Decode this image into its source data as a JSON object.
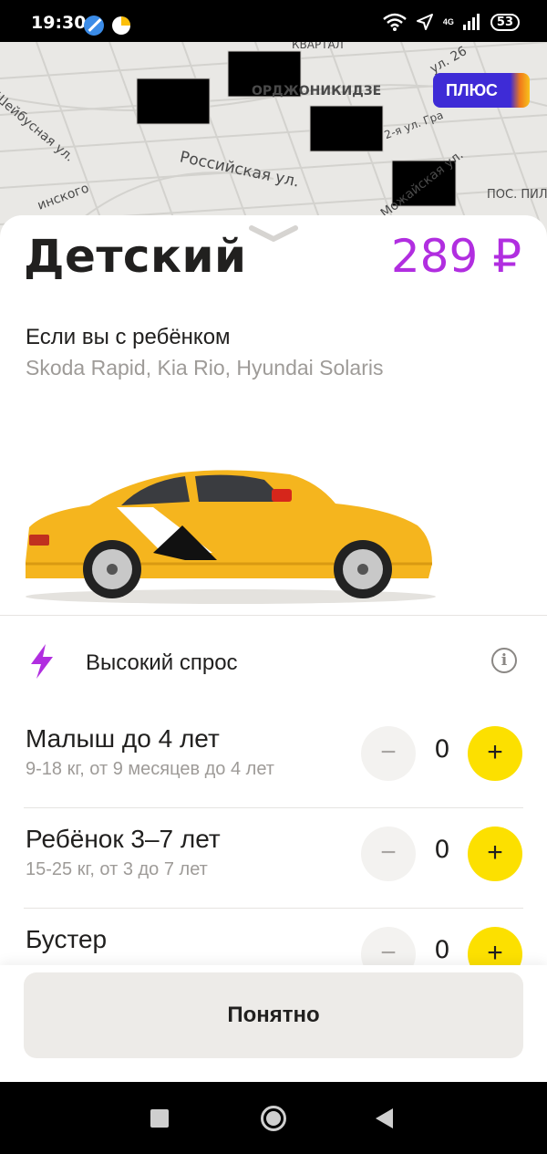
{
  "status_bar": {
    "time": "19:30",
    "network": "4G",
    "battery": "53",
    "icons": [
      "app-icon-blue",
      "app-icon-yellow",
      "wifi-icon",
      "location-arrow-icon",
      "signal-icon",
      "battery-icon"
    ]
  },
  "map": {
    "labels": [
      "ОРДЖОНИКИДЗЕ",
      "Российская ул.",
      "Можайская ул.",
      "ПОС. ПИЛ",
      "Шейбусная ул.",
      "ул. 26",
      "инского",
      "2-я ул. Гра",
      "КВАРТАЛ"
    ],
    "plus_badge": "ПЛЮС",
    "pager": {
      "count": 9,
      "active_index": 4
    }
  },
  "tariff": {
    "name": "Детский",
    "price": "289 ₽",
    "subtitle": "Если вы с ребёнком",
    "models": "Skoda Rapid, Kia Rio, Hyundai Solaris"
  },
  "demand": {
    "label": "Высокий спрос",
    "info_symbol": "i"
  },
  "child_seats": [
    {
      "title": "Малыш до 4 лет",
      "subtitle": "9-18 кг, от 9 месяцев до 4 лет",
      "count": "0",
      "minus": "−",
      "plus": "+"
    },
    {
      "title": "Ребёнок 3–7 лет",
      "subtitle": "15-25 кг, от 3 до 7 лет",
      "count": "0",
      "minus": "−",
      "plus": "+"
    },
    {
      "title": "Бустер",
      "subtitle": "",
      "count": "0",
      "minus": "−",
      "plus": "+"
    }
  ],
  "confirm_button": "Понятно",
  "colors": {
    "accent_price": "#b12ee0",
    "plus_button": "#fce000",
    "plus_badge": "#3e2bd6",
    "taxi_yellow": "#f5b51e"
  }
}
